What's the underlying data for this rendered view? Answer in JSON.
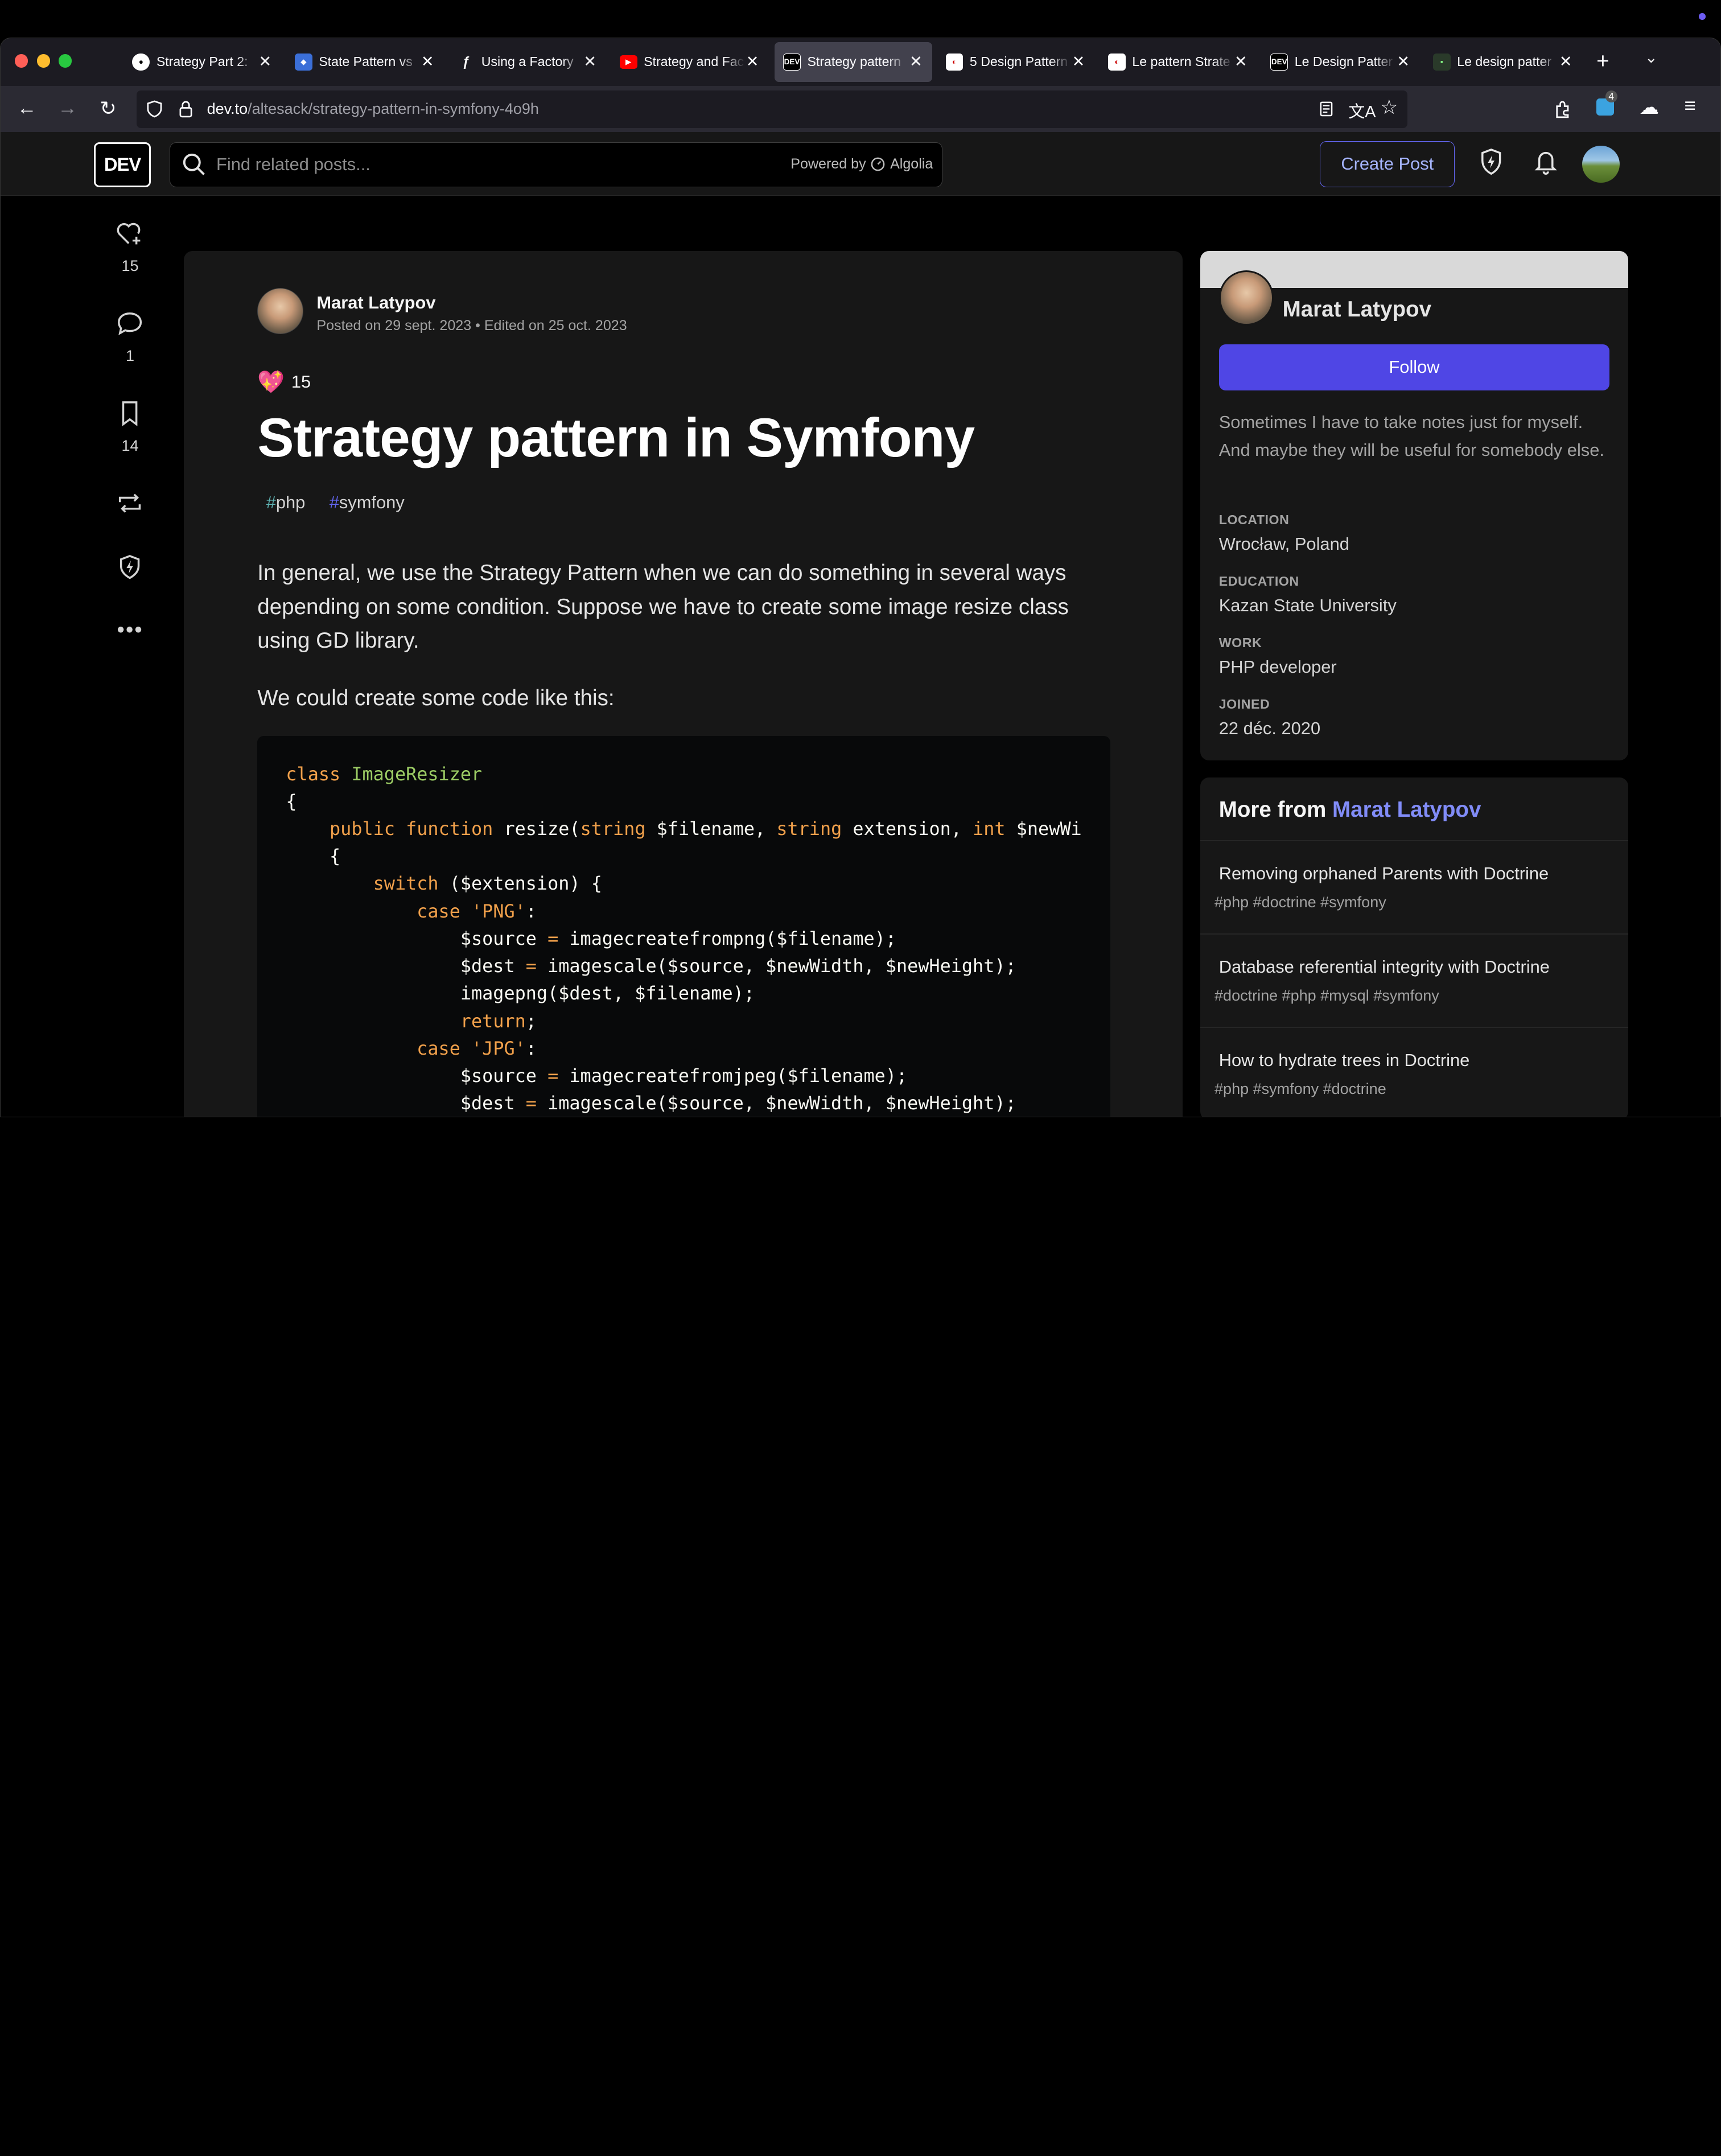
{
  "browser": {
    "tabs": [
      {
        "label": "Strategy Part 2:",
        "favicon": "github-icon",
        "active": false
      },
      {
        "label": "State Pattern vs",
        "favicon": "site-icon",
        "active": false
      },
      {
        "label": "Using a Factory",
        "favicon": "symfony-icon",
        "active": false
      },
      {
        "label": "Strategy and Fac",
        "favicon": "youtube-icon",
        "active": false
      },
      {
        "label": "Strategy pattern",
        "favicon": "dev-icon",
        "active": true
      },
      {
        "label": "5 Design Pattern",
        "favicon": "site-icon",
        "active": false
      },
      {
        "label": "Le pattern Strate",
        "favicon": "site-icon",
        "active": false
      },
      {
        "label": "Le Design Patter",
        "favicon": "dev-icon",
        "active": false
      },
      {
        "label": "Le design patter",
        "favicon": "site-icon",
        "active": false
      }
    ],
    "url_domain": "dev.to",
    "url_path": "/altesack/strategy-pattern-in-symfony-4o9h",
    "extension_badge": "4"
  },
  "header": {
    "logo": "DEV",
    "search_placeholder": "Find related posts...",
    "powered_by": "Powered by",
    "algolia": "Algolia",
    "create_post": "Create Post"
  },
  "actions": {
    "likes": "15",
    "comments": "1",
    "bookmarks": "14"
  },
  "article": {
    "author": "Marat Latypov",
    "meta": "Posted on 29 sept. 2023 • Edited on 25 oct. 2023",
    "reaction_count": "15",
    "title": "Strategy pattern in Symfony",
    "tags": [
      "php",
      "symfony"
    ],
    "paragraph1": "In general, we use the Strategy Pattern when we can do something in several ways depending on some condition. Suppose we have to create some image resize class using GD library.",
    "paragraph2": "We could create some code like this:"
  },
  "profile": {
    "name": "Marat Latypov",
    "follow": "Follow",
    "bio": "Sometimes I have to take notes just for myself. And maybe they will be useful for somebody else.",
    "location_label": "LOCATION",
    "location": "Wrocław, Poland",
    "education_label": "EDUCATION",
    "education": "Kazan State University",
    "work_label": "WORK",
    "work": "PHP developer",
    "joined_label": "JOINED",
    "joined": "22 déc. 2020"
  },
  "more": {
    "heading": "More from",
    "author": "Marat Latypov",
    "items": [
      {
        "title": "Removing orphaned Parents with Doctrine",
        "tags": "#php #doctrine #symfony"
      },
      {
        "title": "Database referential integrity with Doctrine",
        "tags": "#doctrine #php #mysql #symfony"
      },
      {
        "title": "How to hydrate trees in Doctrine",
        "tags": "#php #symfony #doctrine"
      }
    ]
  },
  "colors": {
    "accent": "#4f46e5",
    "link": "#818cf8",
    "background": "#000000",
    "card": "#171717"
  }
}
